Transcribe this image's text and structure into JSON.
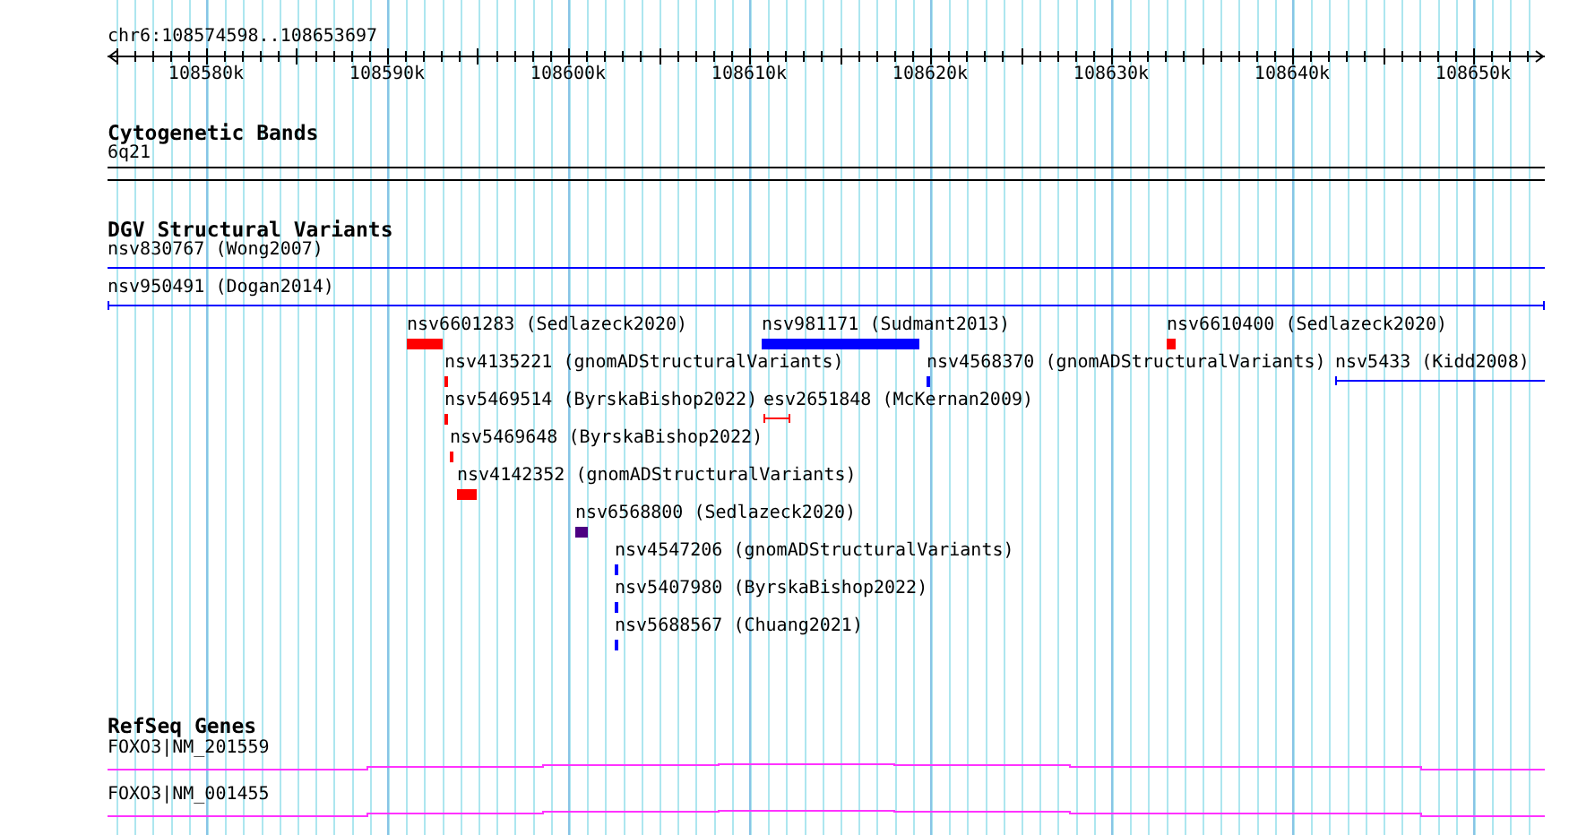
{
  "ruler": {
    "location": "chr6:108574598..108653697",
    "ticks": [
      "108580k",
      "108590k",
      "108600k",
      "108610k",
      "108620k",
      "108630k",
      "108640k",
      "108650k"
    ]
  },
  "tracks": [
    {
      "title": "Cytogenetic Bands",
      "kind": "bands",
      "features": [
        {
          "name": "6q21"
        }
      ]
    },
    {
      "title": "DGV Structural Variants",
      "kind": "variants",
      "features": [
        {
          "name": "nsv830767 (Wong2007)",
          "kind": "line",
          "color": "#0000ff"
        },
        {
          "name": "nsv950491 (Dogan2014)",
          "kind": "line",
          "color": "#0000ff"
        },
        {
          "name": "nsv6601283 (Sedlazeck2020)",
          "kind": "bar",
          "color": "#ff0000"
        },
        {
          "name": "nsv981171 (Sudmant2013)",
          "kind": "bar",
          "color": "#0000ff"
        },
        {
          "name": "nsv6610400 (Sedlazeck2020)",
          "kind": "bar",
          "color": "#ff0000"
        },
        {
          "name": "nsv4135221 (gnomADStructuralVariants)",
          "kind": "bar",
          "color": "#ff0000"
        },
        {
          "name": "nsv4568370 (gnomADStructuralVariants)",
          "kind": "bar",
          "color": "#0000ff"
        },
        {
          "name": "nsv5433 (Kidd2008)",
          "kind": "line",
          "color": "#0000ff"
        },
        {
          "name": "nsv5469514 (ByrskaBishop2022)",
          "kind": "bar",
          "color": "#ff0000"
        },
        {
          "name": "esv2651848 (McKernan2009)",
          "kind": "line",
          "color": "#ff0000"
        },
        {
          "name": "nsv5469648 (ByrskaBishop2022)",
          "kind": "bar",
          "color": "#ff0000"
        },
        {
          "name": "nsv4142352 (gnomADStructuralVariants)",
          "kind": "bar",
          "color": "#ff0000"
        },
        {
          "name": "nsv6568800 (Sedlazeck2020)",
          "kind": "bar",
          "color": "#4b0082"
        },
        {
          "name": "nsv4547206 (gnomADStructuralVariants)",
          "kind": "bar",
          "color": "#0000ff"
        },
        {
          "name": "nsv5407980 (ByrskaBishop2022)",
          "kind": "bar",
          "color": "#0000ff"
        },
        {
          "name": "nsv5688567 (Chuang2021)",
          "kind": "bar",
          "color": "#0000ff"
        }
      ]
    },
    {
      "title": "RefSeq Genes",
      "kind": "genes",
      "features": [
        {
          "name": "FOXO3|NM_201559"
        },
        {
          "name": "FOXO3|NM_001455"
        }
      ]
    }
  ]
}
